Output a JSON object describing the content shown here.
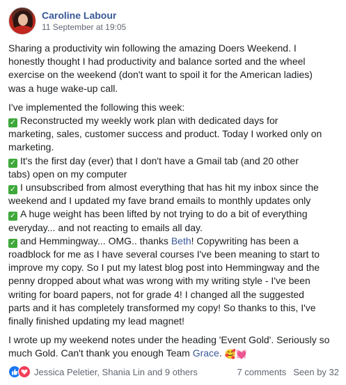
{
  "author": {
    "name": "Caroline Labour",
    "timestamp": "11 September at 19:05"
  },
  "body": {
    "intro": [
      "Sharing a productivity win following the amazing Doers Weekend. I",
      "honestly thought I had productivity and balance sorted and the wheel",
      "exercise on the weekend (don't want to spoil it for the American ladies)",
      "was a huge wake-up call."
    ],
    "list_intro": "I've implemented the following this week:",
    "items": [
      [
        "Reconstructed my weekly work plan with dedicated days for",
        "marketing, sales, customer success and product. Today I worked only on",
        "marketing."
      ],
      [
        "It's the first day (ever) that I don't have a Gmail tab (and 20 other",
        "tabs) open on my computer"
      ],
      [
        "I unsubscribed from almost everything that has hit my inbox since the",
        "weekend and I updated my fave brand emails to monthly updates only"
      ],
      [
        "A huge weight has been lifted by not trying to do a bit of everything",
        "everyday... and not reacting to emails all day."
      ]
    ],
    "last_item": {
      "pre": "and Hemmingway... OMG.. thanks ",
      "mention": "Beth",
      "post": "! Copywriting has been a",
      "lines": [
        "roadblock for me as I have several courses I've been meaning to start to",
        "improve my copy. So I put my latest blog post into Hemmingway and the",
        "penny dropped about what was wrong with my writing style - I've been",
        "writing for board papers, not for grade 4! I changed all the suggested",
        "parts and it has completely transformed my copy! So thanks to this, I've",
        "finally finished updating my lead magnet!"
      ]
    },
    "closing": {
      "line1": "I wrote up my weekend notes under the heading 'Event Gold'. Seriously so",
      "line2_pre": "much Gold. Can't thank you enough Team ",
      "mention": "Grace",
      "line2_post": ".",
      "emojis": "🥰💓"
    }
  },
  "footer": {
    "reactions": "Jessica Peletier, Shania Lin and 9 others",
    "comments": "7 comments",
    "seen": "Seen by 32"
  },
  "colors": {
    "link": "#385898",
    "like": "#1877f2",
    "love": "#f33e58",
    "check": "#3ea83a"
  }
}
